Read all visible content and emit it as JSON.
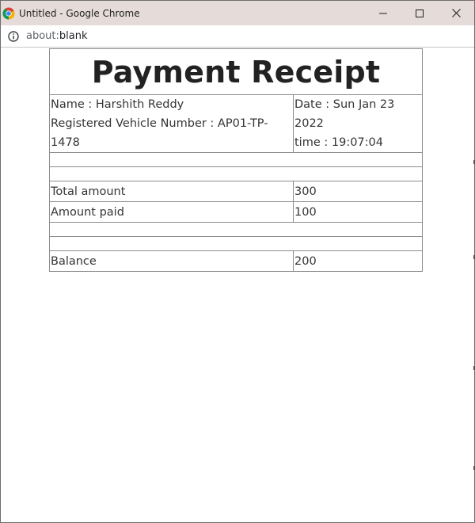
{
  "window": {
    "title": "Untitled - Google Chrome",
    "url_scheme": "about:",
    "url_host": "blank"
  },
  "receipt": {
    "heading": "Payment Receipt",
    "name_line": "Name : Harshith Reddy",
    "vehicle_line": "Registered Vehicle Number : AP01-TP-1478",
    "date_line": "Date : Sun Jan 23 2022",
    "time_line": "time : 19:07:04",
    "total_label": "Total amount",
    "total_value": "300",
    "paid_label": "Amount paid",
    "paid_value": "100",
    "balance_label": "Balance",
    "balance_value": "200"
  }
}
